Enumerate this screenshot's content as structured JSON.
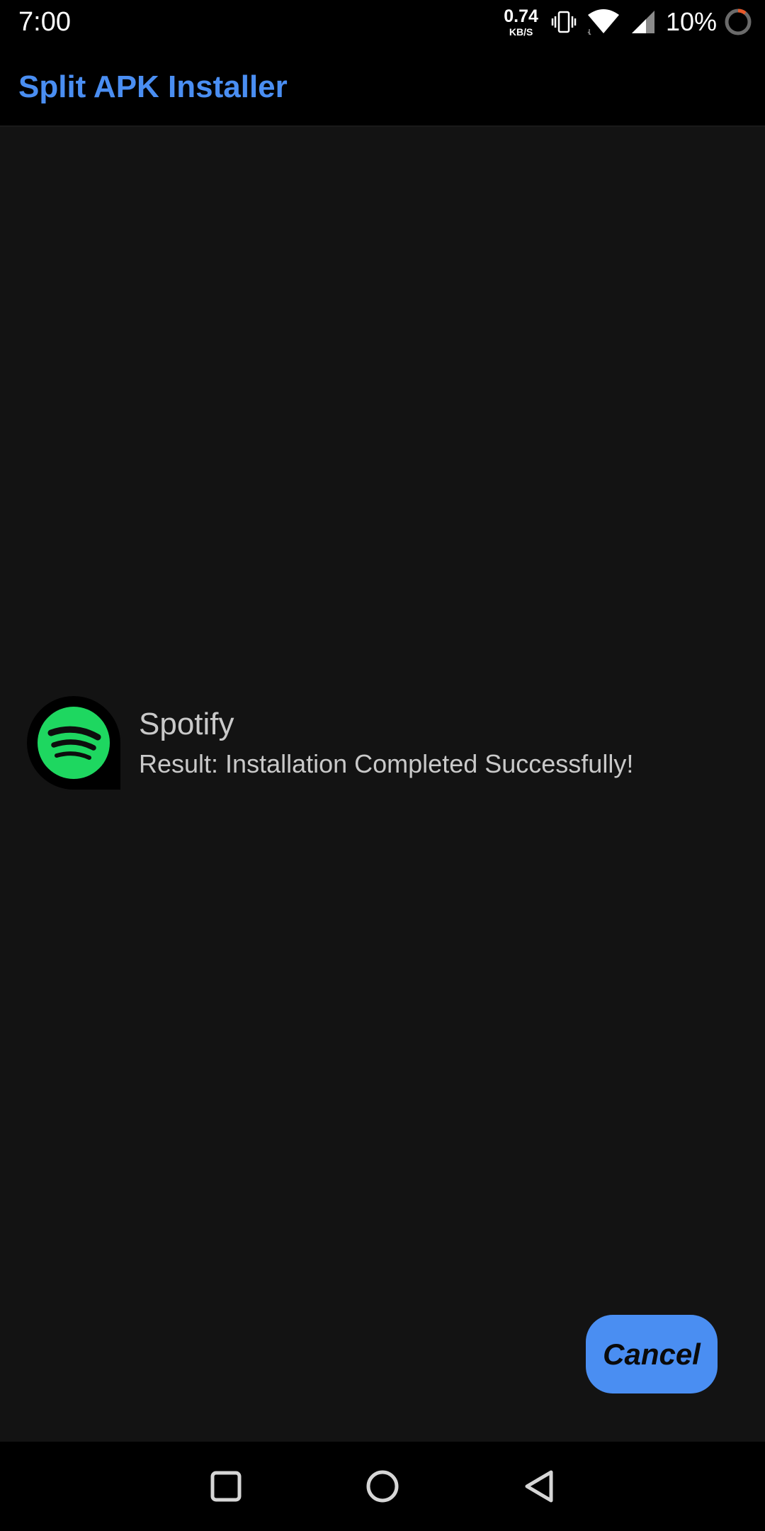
{
  "status_bar": {
    "time": "7:00",
    "net_speed_value": "0.74",
    "net_speed_unit": "KB/S",
    "battery_percent": "10%",
    "icons": [
      "vibrate-icon",
      "wifi-icon",
      "cellular-signal-icon",
      "battery-ring-icon"
    ]
  },
  "app_bar": {
    "title": "Split APK Installer"
  },
  "install_item": {
    "app_name": "Spotify",
    "result": "Result: Installation Completed Successfully!",
    "icon": "spotify-icon"
  },
  "actions": {
    "cancel_label": "Cancel"
  },
  "nav_bar": {
    "icons": [
      "recents-square-icon",
      "home-circle-icon",
      "back-triangle-icon"
    ]
  },
  "colors": {
    "accent": "#4a8ef2",
    "background": "#131313",
    "bar_background": "#000000",
    "spotify_green": "#1ed760",
    "battery_low": "#e8582a"
  }
}
